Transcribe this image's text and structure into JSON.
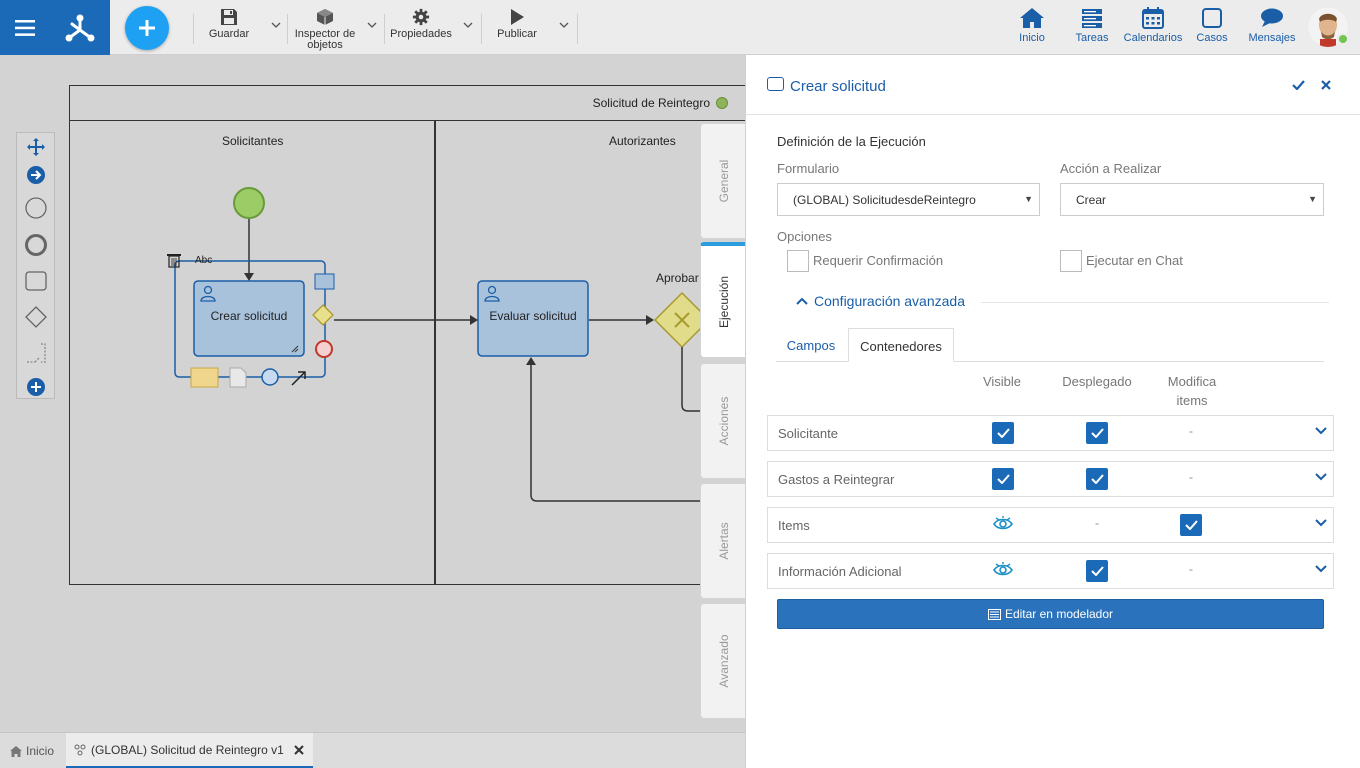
{
  "toolbar": {
    "guardar": "Guardar",
    "inspector_line1": "Inspector de",
    "inspector_line2": "objetos",
    "propiedades": "Propiedades",
    "publicar": "Publicar"
  },
  "nav": {
    "inicio": "Inicio",
    "tareas": "Tareas",
    "calendarios": "Calendarios",
    "casos": "Casos",
    "mensajes": "Mensajes"
  },
  "diagram": {
    "pool_title": "Solicitud de Reintegro",
    "lane_solicitantes": "Solicitantes",
    "lane_autorizantes": "Autorizantes",
    "task_crear": "Crear solicitud",
    "task_evaluar": "Evaluar solicitud",
    "gateway_label": "Aprobar",
    "text_tool": "Abc"
  },
  "bottom_tabs": {
    "home": "Inicio",
    "process": "(GLOBAL) Solicitud de Reintegro v1"
  },
  "side_tabs": [
    "General",
    "Ejecución",
    "Acciones",
    "Alertas",
    "Avanzado"
  ],
  "panel": {
    "title": "Crear solicitud",
    "section": "Definición de la Ejecución",
    "formulario_label": "Formulario",
    "formulario_value": "(GLOBAL) SolicitudesdeReintegro",
    "accion_label": "Acción a Realizar",
    "accion_value": "Crear",
    "opciones_label": "Opciones",
    "requerir": "Requerir Confirmación",
    "ejecutar_chat": "Ejecutar en Chat",
    "config_avanzada": "Configuración avanzada",
    "tab_campos": "Campos",
    "tab_contenedores": "Contenedores",
    "col_visible": "Visible",
    "col_desplegado": "Desplegado",
    "col_modifica_1": "Modifica",
    "col_modifica_2": "items",
    "rows": [
      {
        "name": "Solicitante",
        "dash": "-"
      },
      {
        "name": "Gastos a Reintegrar",
        "dash": "-"
      },
      {
        "name": "Items",
        "dash": "-"
      },
      {
        "name": "Información Adicional",
        "dash": "-"
      }
    ],
    "edit_button": "Editar en modelador"
  },
  "colors": {
    "brand": "#1a6ab8",
    "accent": "#1ea1f2",
    "link": "#1a5ea8"
  }
}
